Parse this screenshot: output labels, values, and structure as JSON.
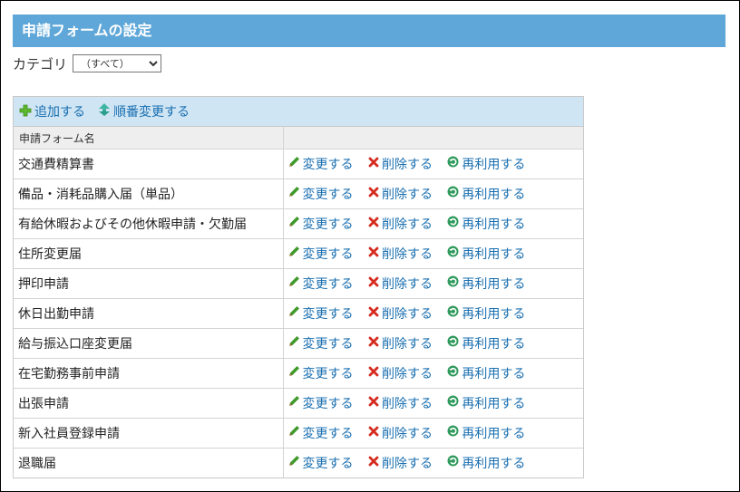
{
  "page": {
    "title": "申請フォームの設定"
  },
  "category": {
    "label": "カテゴリ",
    "selected": "（すべて）"
  },
  "toolbar": {
    "add_label": "追加する",
    "reorder_label": "順番変更する"
  },
  "table": {
    "header": "申請フォーム名",
    "action_labels": {
      "edit": "変更する",
      "delete": "削除する",
      "reuse": "再利用する"
    },
    "rows": [
      {
        "name": "交通費精算書"
      },
      {
        "name": "備品・消耗品購入届（単品）"
      },
      {
        "name": "有給休暇およびその他休暇申請・欠勤届"
      },
      {
        "name": "住所変更届"
      },
      {
        "name": "押印申請"
      },
      {
        "name": "休日出勤申請"
      },
      {
        "name": "給与振込口座変更届"
      },
      {
        "name": "在宅勤務事前申請"
      },
      {
        "name": "出張申請"
      },
      {
        "name": "新入社員登録申請"
      },
      {
        "name": "退職届"
      }
    ]
  },
  "colors": {
    "title_bg": "#5ea7d8",
    "toolbar_bg": "#cfe5f4",
    "link": "#1a6fb0",
    "edit_icon": "#3f9a2b",
    "delete_icon": "#d62b1f",
    "reuse_icon": "#2f9a5c"
  },
  "icons": {
    "add": "plus-icon",
    "reorder": "up-down-arrows-icon",
    "edit": "pencil-icon",
    "delete": "x-icon",
    "reuse": "recycle-icon"
  }
}
